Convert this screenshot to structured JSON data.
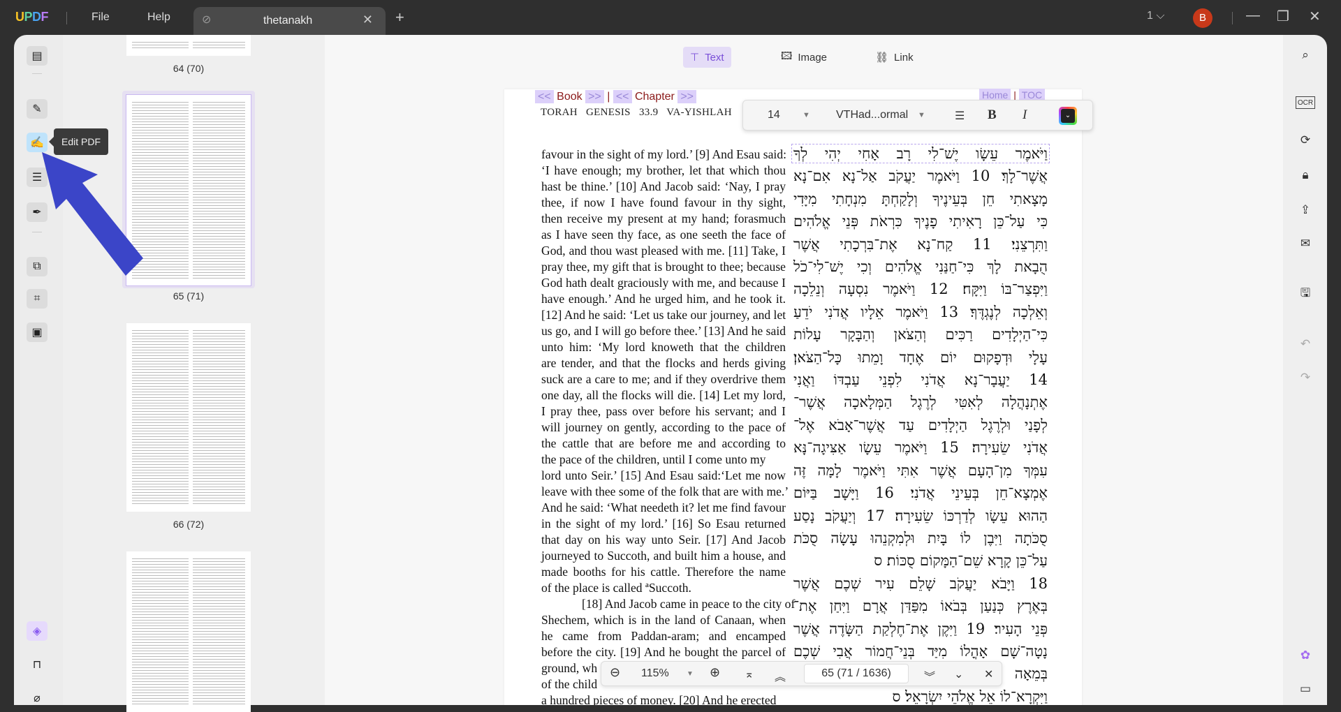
{
  "app": {
    "logo": "UPDF",
    "menu": [
      "File",
      "Help"
    ],
    "tab_title": "thetanakh",
    "page_selector": "1",
    "avatar_letter": "B"
  },
  "left_rail": {
    "tooltip": "Edit PDF",
    "items": [
      "reader",
      "comment",
      "edit-pdf",
      "form",
      "fill-sign",
      "organize-pages",
      "crop",
      "watermark"
    ],
    "bottom": [
      "layers",
      "bookmark",
      "attachment"
    ]
  },
  "thumbnails": [
    {
      "label": "64 (70)"
    },
    {
      "label": "65 (71)",
      "selected": true
    },
    {
      "label": "66 (72)"
    },
    {
      "label": ""
    }
  ],
  "edit_toolbar": {
    "text": "Text",
    "image": "Image",
    "link": "Link",
    "active": "Text"
  },
  "format_toolbar": {
    "font_size": "14",
    "font_name": "VTHad...ormal",
    "bold": "B",
    "italic": "I",
    "color": "#222222"
  },
  "page": {
    "nav": {
      "prev_book": "<<",
      "book": "Book",
      "next_book": ">>",
      "divider": "|",
      "prev_chapter": "<<",
      "chapter": "Chapter",
      "next_chapter": ">>",
      "home": "Home",
      "toc": "TOC"
    },
    "header": "TORAH   GENESIS   33.9   VA-YISHLAH",
    "english": [
      "favour in the sight of my lord.’ [9] And Esau said:",
      "‘I have enough; my brother, let that which thou",
      "hast be thine.’ [10] And Jacob said: ‘Nay, I pray",
      "thee, if now I have found favour in thy sight,",
      "then receive my present at my hand; forasmuch",
      "as I have seen thy face, as one seeth the face of",
      "God, and thou wast pleased with me. [11] Take, I",
      "pray thee, my gift that is brought to thee; because",
      "God hath dealt graciously with me, and because I",
      "have enough.’ And he urged him, and he took it.",
      "[12] And he said: ‘Let us take our journey, and let",
      "us go, and I will go before thee.’ [13] And he said",
      "unto him: ‘My lord knoweth that the children",
      "are tender, and that the flocks and herds giving",
      "suck are a care to me; and if they overdrive them",
      "one day, all the flocks will die. [14] Let my lord,",
      "I pray thee, pass over before his servant; and I",
      "will journey on gently, according to the pace of",
      "the cattle that are before me and according to",
      "the pace of the children, until I come unto my",
      "lord unto Seir.’ [15] And Esau said:‘Let me now",
      "leave with thee some of the folk that are with me.’",
      "And he said: ‘What needeth it? let me find favour",
      "in the sight of my lord.’ [16] So Esau returned",
      "that day on his way unto Seir. [17] And Jacob",
      "journeyed to Succoth, and built him a house, and",
      "made booths for his cattle. Therefore the name",
      "of the place is called ªSuccoth.",
      "        [18] And Jacob came in peace to the city of",
      "Shechem, which is in the land of Canaan, when",
      "he came from Paddan-aram; and encamped",
      "before the city. [19] And he bought the parcel of",
      "ground, wh",
      "of the child",
      "a hundred pieces of money. [20] And he erected"
    ],
    "hebrew": [
      "וַיֹּאמֶר עֵשָׂו יֶשׁ־לִי רָב אָחִי יְהִי לְךָ",
      "אֲשֶׁר־לָךְ׃ 10 וַיֹּאמֶר יַעֲקֹב אַל־נָא אִם־נָא",
      "מָצָאתִי חֵן בְּעֵינֶיךָ וְלָקַחְתָּ מִנְחָתִי מִיָּדִי",
      "כִּי עַל־כֵּן רָאִיתִי פָנֶיךָ כִּרְאֹת פְּנֵי אֱלֹהִים",
      "וַתִּרְצֵנִי׃ 11 קַח־נָא אֶת־בִּרְכָתִי אֲשֶׁר",
      "הֻבָאת לָךְ כִּי־חַנַּנִי אֱלֹהִים וְכִי יֶשׁ־לִי־כֹל",
      "וַיִּפְצַר־בּוֹ וַיִּקָּח׃ 12 וַיֹּאמֶר נִסְעָה וְנֵלֵכָה",
      "וְאֵלְכָה לְנֶגְדֶּךָ׃ 13 וַיֹּאמֶר אֵלָיו אֲדֹנִי יֹדֵעַ",
      "כִּי־הַיְלָדִים רַכִּים וְהַצֹּאן וְהַבָּקָר עָלוֹת",
      "עָלָי וּדְפָקוּם יוֹם אֶחָד וָמֵתוּ כָּל־הַצֹּאן׃",
      "14 יַעֲבָר־נָא אֲדֹנִי לִפְנֵי עַבְדּוֹ וַאֲנִי",
      "אֶתְנָהֲלָה לְאִטִּי לְרֶגֶל הַמְּלָאכָה אֲשֶׁר־",
      "לְפָנַי וּלְרֶגֶל הַיְלָדִים עַד אֲשֶׁר־אָבֹא אֶל־",
      "אֲדֹנִי שֵׂעִירָה׃ 15 וַיֹּאמֶר עֵשָׂו אַצִּיגָה־נָּא",
      "עִמְּךָ מִן־הָעָם אֲשֶׁר אִתִּי וַיֹּאמֶר לָמָּה זֶּה",
      "אֶמְצָא־חֵן בְּעֵינֵי אֲדֹנִי׃ 16 וַיָּשָׁב בַּיּוֹם",
      "הַהוּא עֵשָׂו לְדַרְכּוֹ שֵׂעִירָה׃ 17 וְיַעֲקֹב נָסַע",
      "סֻכֹּתָה וַיִּבֶן לוֹ בָּיִת וּלְמִקְנֵהוּ עָשָׂה סֻכֹּת",
      "עַל־כֵּן קָרָא שֵׁם־הַמָּקוֹם סֻכּוֹת׃   ס",
      "18 וַיָּבֹא יַעֲקֹב שָׁלֵם עִיר שְׁכֶם אֲשֶׁר",
      "בְּאֶרֶץ כְּנַעַן בְּבֹאוֹ מִפַּדַּן אֲרָם וַיִּחַן אֶת־",
      "פְּנֵי הָעִיר׃ 19 וַיִּקֶן אֶת־חֶלְקַת הַשָּׂדֶה אֲשֶׁר",
      "נָטָה־שָׁם אָהֳלוֹ מִיַּד בְּנֵי־חֲמוֹר אֲבִי שְׁכֶם",
      "בְּמֵאָה",
      "וַיִּקְרָא־לוֹ אֵל אֱלֹהֵי יִשְׂרָאֵל׃   ס"
    ]
  },
  "bottom_nav": {
    "zoom": "115%",
    "page_indicator": "65  (71 / 1636)"
  },
  "colors": {
    "titlebar": "#2f2f2f",
    "accent": "#7a4fd8",
    "arrow": "#3b45c8",
    "nav_red": "#8b1a1a"
  }
}
